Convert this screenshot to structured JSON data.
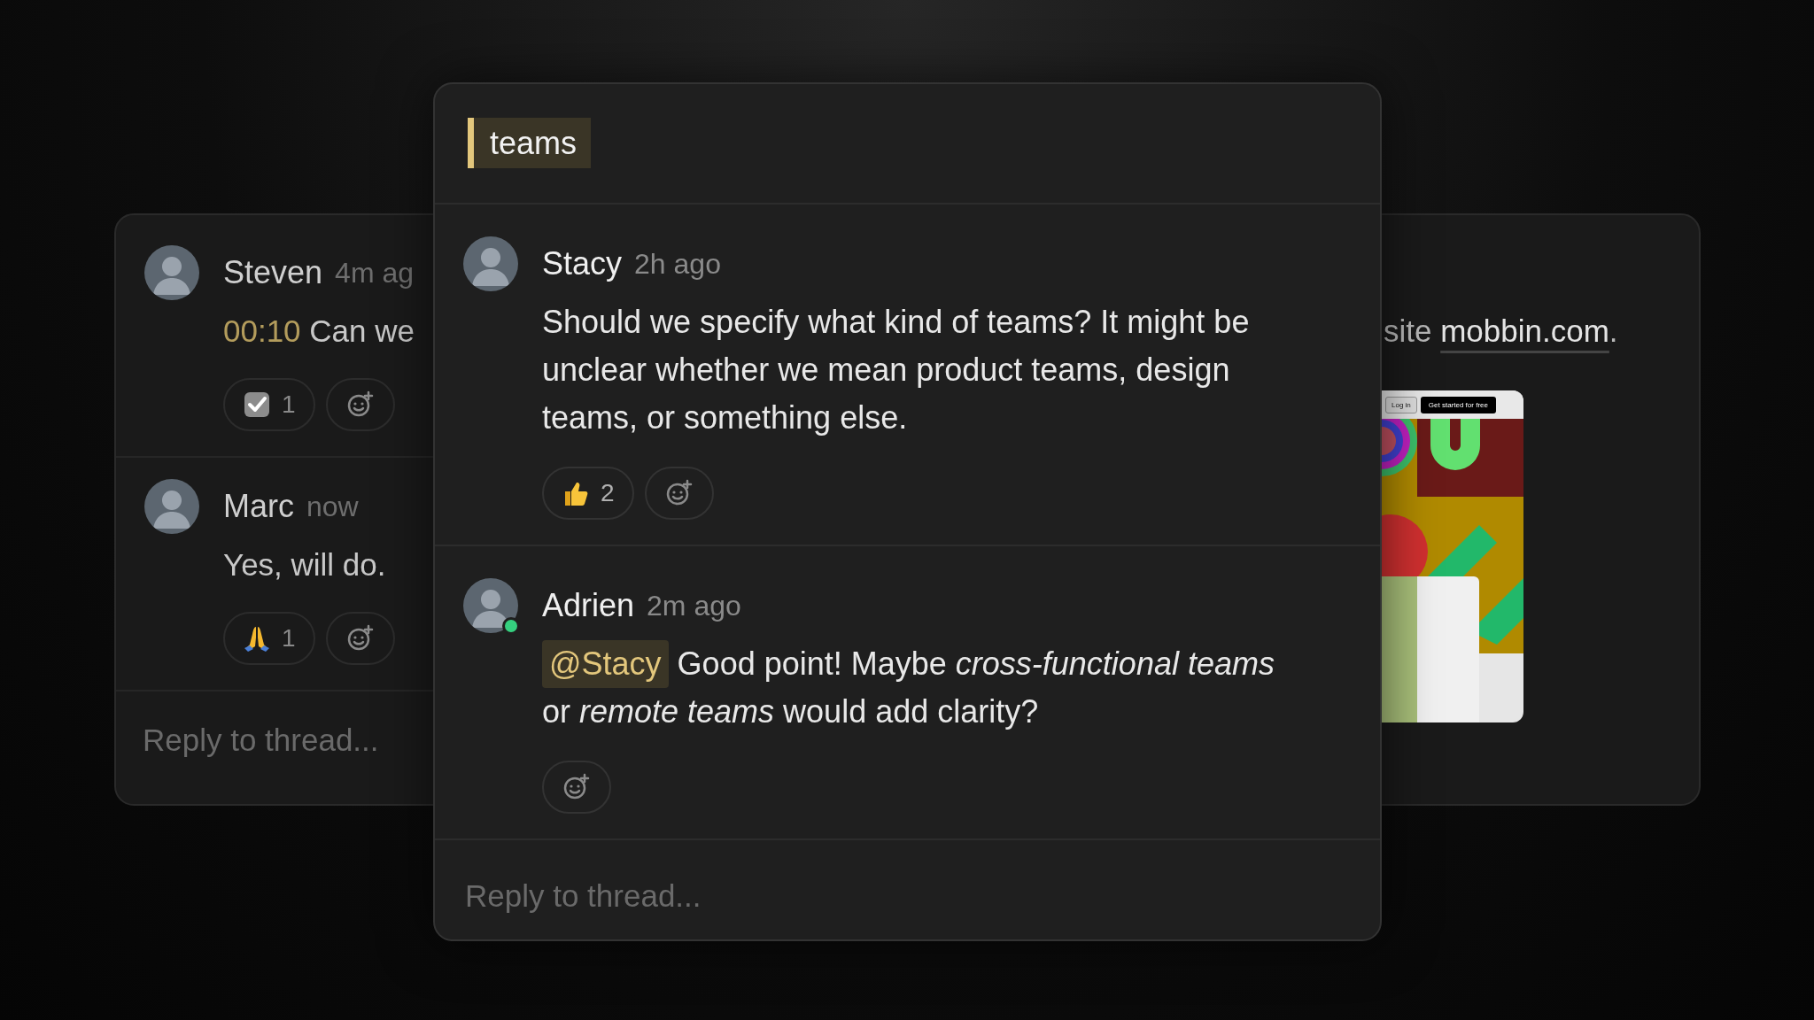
{
  "back_card": {
    "threads": [
      {
        "author": "Steven",
        "time": "4m ag",
        "timestamp": "00:10",
        "text": "Can we",
        "reactions": [
          {
            "kind": "check",
            "count": "1"
          },
          {
            "kind": "add"
          }
        ]
      },
      {
        "author": "Marc",
        "time": "now",
        "text": "Yes, will do.",
        "reactions": [
          {
            "kind": "pray",
            "count": "1"
          },
          {
            "kind": "add"
          }
        ]
      }
    ],
    "reply_placeholder": "Reply to thread...",
    "note": {
      "before": "site ",
      "link": "mobbin.com",
      "after": "."
    },
    "preview": {
      "buttons": [
        {
          "label": "Log in",
          "kind": "secondary"
        },
        {
          "label": "Get started for free",
          "kind": "primary"
        }
      ]
    }
  },
  "thread": {
    "highlight": "teams",
    "messages": [
      {
        "author": "Stacy",
        "time": "2h ago",
        "online": false,
        "text": "Should we specify what kind of teams? It might be unclear whether we mean product teams, design teams, or something else.",
        "reactions": [
          {
            "kind": "thumbs",
            "count": "2"
          },
          {
            "kind": "add"
          }
        ]
      },
      {
        "author": "Adrien",
        "time": "2m ago",
        "online": true,
        "mention": "@Stacy",
        "text": "Good point! Maybe *cross-functional teams* or *remote teams* would add clarity?",
        "reactions": [
          {
            "kind": "add"
          }
        ]
      }
    ],
    "reply_placeholder": "Reply to thread..."
  }
}
